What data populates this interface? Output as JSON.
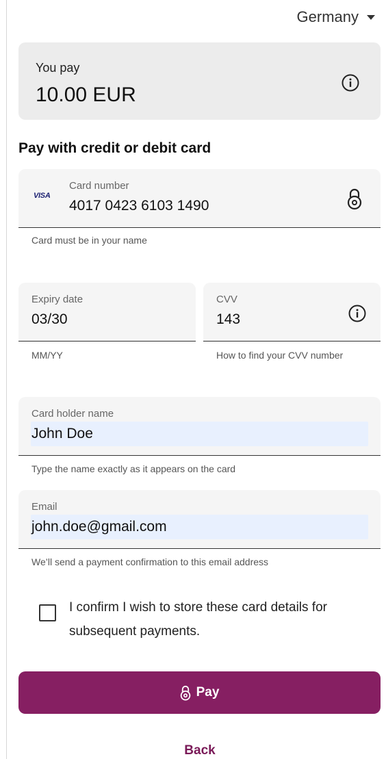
{
  "header": {
    "country": "Germany"
  },
  "summary": {
    "label": "You pay",
    "amount": "10.00 EUR"
  },
  "section_title": "Pay with credit or debit card",
  "card": {
    "brand": "VISA",
    "label": "Card number",
    "value": "4017 0423 6103 1490",
    "hint": "Card must be in your name"
  },
  "expiry": {
    "label": "Expiry date",
    "value": "03/30",
    "hint": "MM/YY"
  },
  "cvv": {
    "label": "CVV",
    "value": "143",
    "hint": "How to find your CVV number"
  },
  "holder": {
    "label": "Card holder name",
    "value": "John Doe",
    "hint": "Type the name exactly as it appears on the card"
  },
  "email": {
    "label": "Email",
    "value": "john.doe@gmail.com",
    "hint": "We’ll send a payment confirmation to this email address"
  },
  "confirm": {
    "text": "I confirm I wish to store these card details for subsequent payments.",
    "checked": false
  },
  "pay_button": {
    "label": "Pay"
  },
  "back_link": {
    "label": "Back"
  },
  "colors": {
    "primary": "#861f62",
    "link": "#7a1a58",
    "field_bg": "#f5f5f5",
    "autofill_bg": "#e8f0fe"
  }
}
